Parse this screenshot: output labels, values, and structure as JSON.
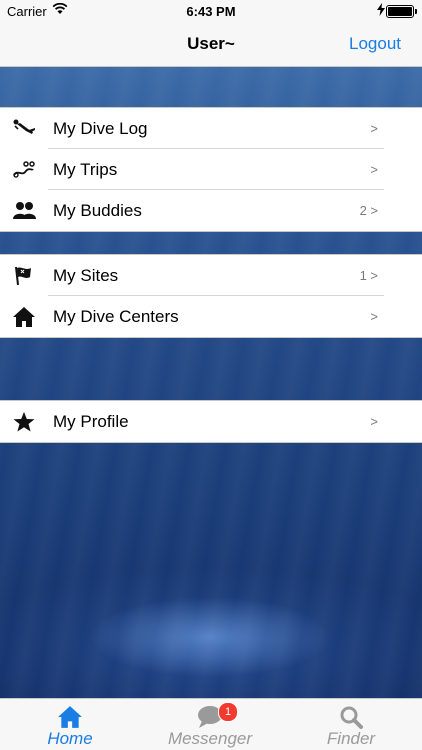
{
  "status_bar": {
    "carrier": "Carrier",
    "time": "6:43 PM"
  },
  "nav": {
    "title": "User~",
    "logout_label": "Logout"
  },
  "groups": [
    {
      "rows": [
        {
          "label": "My Dive Log",
          "detail": ">",
          "icon": "diver-icon"
        },
        {
          "label": "My Trips",
          "detail": ">",
          "icon": "trips-icon"
        },
        {
          "label": "My Buddies",
          "detail": "2 >",
          "icon": "buddies-icon"
        }
      ]
    },
    {
      "rows": [
        {
          "label": "My Sites",
          "detail": "1 >",
          "icon": "flag-icon"
        },
        {
          "label": "My Dive Centers",
          "detail": ">",
          "icon": "home-icon"
        }
      ]
    },
    {
      "rows": [
        {
          "label": "My Profile",
          "detail": ">",
          "icon": "star-icon"
        }
      ]
    }
  ],
  "tabbar": {
    "tabs": [
      {
        "label": "Home",
        "icon": "home-icon",
        "active": true
      },
      {
        "label": "Messenger",
        "icon": "chat-bubble-icon",
        "badge": "1"
      },
      {
        "label": "Finder",
        "icon": "search-icon"
      }
    ]
  },
  "colors": {
    "accent": "#1a7de3",
    "inactive_tab": "#9a9a9a",
    "badge": "#f23b2f"
  }
}
